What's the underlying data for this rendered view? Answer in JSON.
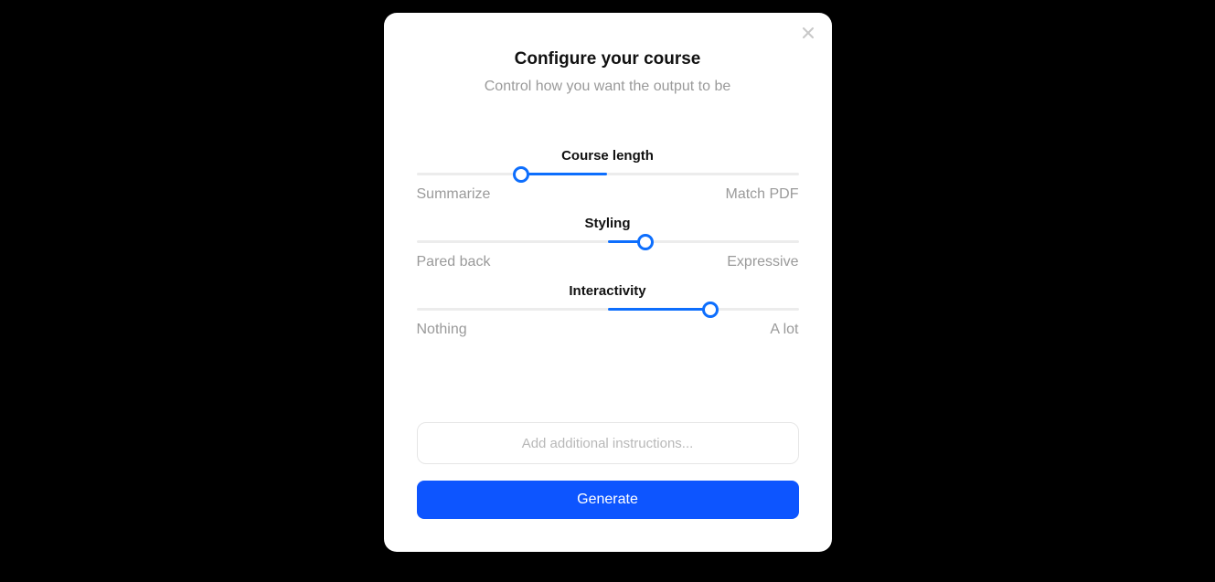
{
  "modal": {
    "title": "Configure your course",
    "subtitle": "Control how you want the output to be"
  },
  "sliders": {
    "course_length": {
      "label": "Course length",
      "left": "Summarize",
      "right": "Match PDF",
      "fill_start_pct": 27.5,
      "fill_end_pct": 50,
      "thumb_pct": 27.5
    },
    "styling": {
      "label": "Styling",
      "left": "Pared back",
      "right": "Expressive",
      "fill_start_pct": 50,
      "fill_end_pct": 60,
      "thumb_pct": 60
    },
    "interactivity": {
      "label": "Interactivity",
      "left": "Nothing",
      "right": "A lot",
      "fill_start_pct": 50,
      "fill_end_pct": 77,
      "thumb_pct": 77
    }
  },
  "instructions": {
    "placeholder": "Add additional instructions...",
    "value": ""
  },
  "actions": {
    "generate_label": "Generate"
  },
  "colors": {
    "accent": "#0d55ff",
    "slider_accent": "#0d6efd",
    "muted_text": "#9a9a9a"
  }
}
